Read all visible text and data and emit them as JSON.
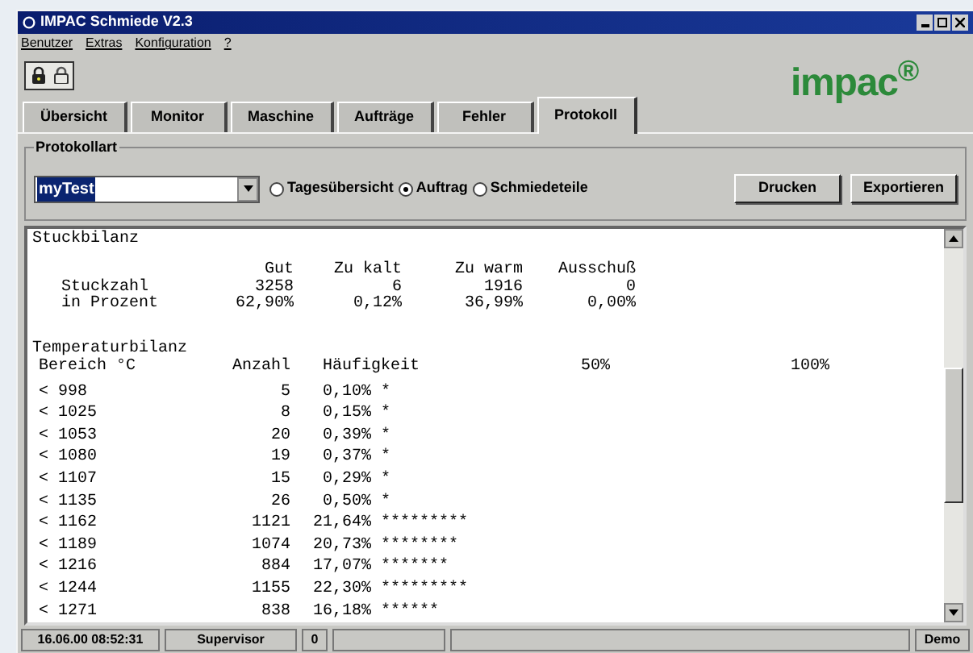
{
  "window": {
    "title": "IMPAC Schmiede V2.3"
  },
  "menu": [
    "Benutzer",
    "Extras",
    "Konfiguration",
    "?"
  ],
  "logo": "impac$^{®}$",
  "tabs": [
    {
      "label": "Übersicht",
      "selected": false
    },
    {
      "label": "Monitor",
      "selected": false
    },
    {
      "label": "Maschine",
      "selected": false
    },
    {
      "label": "Aufträge",
      "selected": false
    },
    {
      "label": "Fehler",
      "selected": false
    },
    {
      "label": "Protokoll",
      "selected": true
    }
  ],
  "protokollart": {
    "label": "Protokollart",
    "combo_value": "myTest",
    "options": [
      {
        "label": "Tagesübersicht",
        "selected": false
      },
      {
        "label": "Auftrag",
        "selected": true
      },
      {
        "label": "Schmiedeteile",
        "selected": false
      }
    ],
    "buttons": [
      "Drucken",
      "Exportieren"
    ]
  },
  "report": {
    "stueckbilanz": {
      "title": "Stuckbilanz",
      "columns": [
        "Gut",
        "Zu kalt",
        "Zu warm",
        "Ausschuß"
      ],
      "rows": [
        {
          "label": "Stuckzahl",
          "values": [
            "3258",
            "6",
            "1916",
            "0"
          ]
        },
        {
          "label": "in Prozent",
          "values": [
            "62,90%",
            "0,12%",
            "36,99%",
            "0,00%"
          ]
        }
      ]
    },
    "temperaturbilanz": {
      "title": "Temperaturbilanz",
      "columns": [
        "Bereich °C",
        "Anzahl",
        "Häufigkeit",
        "50%",
        "100%"
      ],
      "rows": [
        {
          "range": "< 998",
          "count": "5",
          "percent": "0,10%",
          "bar": "*"
        },
        {
          "range": "< 1025",
          "count": "8",
          "percent": "0,15%",
          "bar": "*"
        },
        {
          "range": "< 1053",
          "count": "20",
          "percent": "0,39%",
          "bar": "*"
        },
        {
          "range": "< 1080",
          "count": "19",
          "percent": "0,37%",
          "bar": "*"
        },
        {
          "range": "< 1107",
          "count": "15",
          "percent": "0,29%",
          "bar": "*"
        },
        {
          "range": "< 1135",
          "count": "26",
          "percent": "0,50%",
          "bar": "*"
        },
        {
          "range": "< 1162",
          "count": "1121",
          "percent": "21,64%",
          "bar": "*********"
        },
        {
          "range": "< 1189",
          "count": "1074",
          "percent": "20,73%",
          "bar": "********"
        },
        {
          "range": "< 1216",
          "count": "884",
          "percent": "17,07%",
          "bar": "*******"
        },
        {
          "range": "< 1244",
          "count": "1155",
          "percent": "22,30%",
          "bar": "*********"
        },
        {
          "range": "< 1271",
          "count": "838",
          "percent": "16,18%",
          "bar": "******"
        }
      ]
    }
  },
  "status_bar": {
    "datetime": "16.06.00 08:52:31",
    "user": "Supervisor",
    "count": "0",
    "mode": "Demo"
  }
}
